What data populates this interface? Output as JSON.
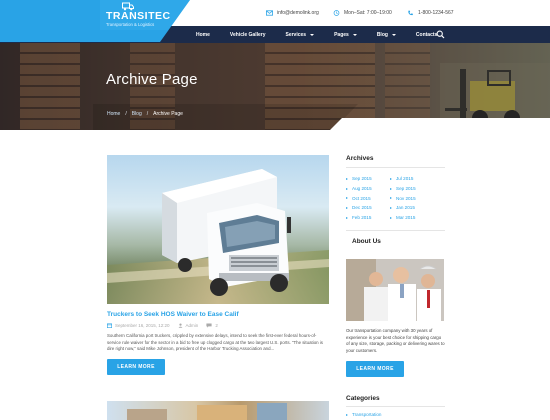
{
  "brand": {
    "name": "TRANSITEC",
    "tagline": "Transportation & Logistics",
    "accent_color": "#29a3e6",
    "nav_color": "#1c2b4a"
  },
  "contacts": [
    {
      "icon": "envelope-icon",
      "text": "info@demolink.org"
    },
    {
      "icon": "clock-icon",
      "text": "Mon–Sat: 7:00–19:00"
    },
    {
      "icon": "phone-icon",
      "text": "1-800-1234-567"
    }
  ],
  "nav": {
    "items": [
      {
        "label": "Home",
        "has_dropdown": false
      },
      {
        "label": "Vehicle Gallery",
        "has_dropdown": false
      },
      {
        "label": "Services",
        "has_dropdown": true
      },
      {
        "label": "Pages",
        "has_dropdown": true
      },
      {
        "label": "Blog",
        "has_dropdown": true
      },
      {
        "label": "Contacts",
        "has_dropdown": false
      }
    ],
    "search_icon": "search-icon"
  },
  "hero": {
    "title": "Archive Page",
    "breadcrumb": [
      "Home",
      "Blog",
      "Archive Page"
    ]
  },
  "post": {
    "title": "Truckers to Seek HOS Waiver to Ease Calif",
    "date": "September 16, 2015, 12:20",
    "author": "Admin",
    "comments": "2",
    "excerpt": "Southern California port truckers, crippled by extensive delays, intend to seek the first-ever federal hours-of-service rule waiver for the sector in a bid to free up clogged cargo at the two largest U.S. ports. “The situation is dire right now,” said Mike Johnson, president of the Harbor Trucking Association and...",
    "button": "LEARN MORE"
  },
  "sidebar": {
    "archives": {
      "heading": "Archives",
      "col1": [
        "Sep 2015",
        "Aug 2015",
        "Oct 2015",
        "Dec 2015",
        "Feb 2015"
      ],
      "col2": [
        "Jul 2015",
        "Sep 2015",
        "Nov 2015",
        "Jan 2015",
        "Mar 2015"
      ]
    },
    "about": {
      "heading": "About Us",
      "text": "Our transportation company with 30 years of experience is your best choice for shipping cargo of any size, storage, packing or delivering wares to your customers.",
      "button": "LEARN MORE"
    },
    "categories": {
      "heading": "Categories",
      "items": [
        "Transportation"
      ]
    }
  }
}
